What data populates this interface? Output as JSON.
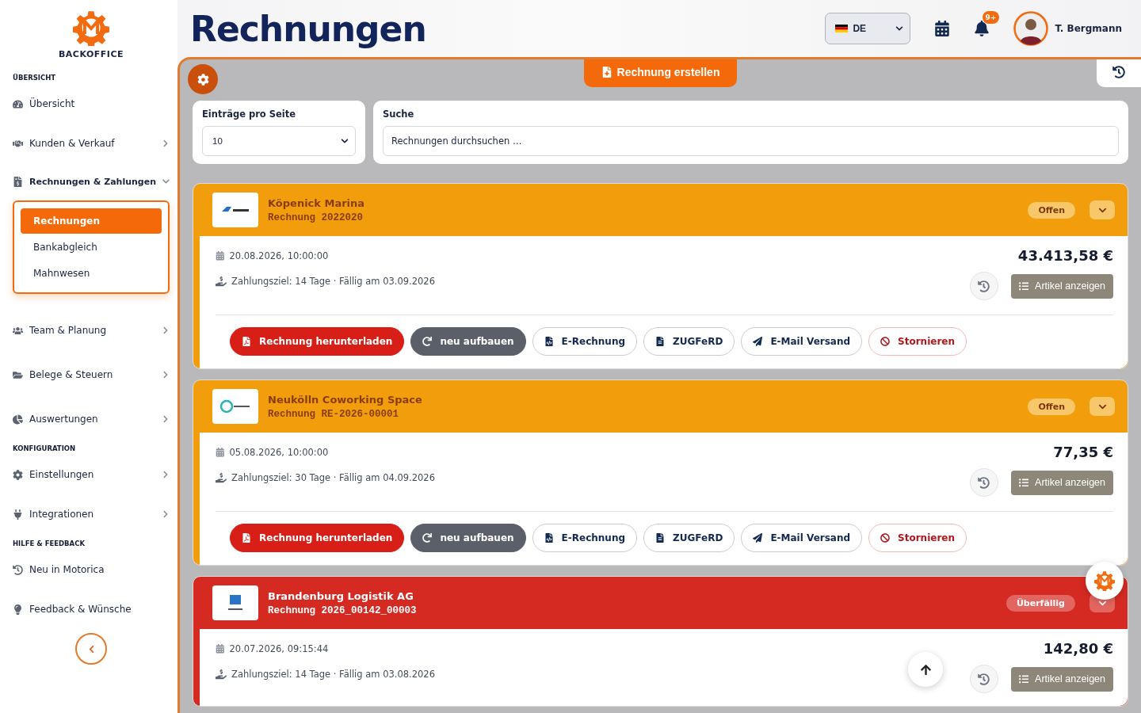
{
  "brand": {
    "name": "BACKOFFICE"
  },
  "sidebar": {
    "sections": [
      {
        "heading": "ÜBERSICHT",
        "items": [
          {
            "label": "Übersicht",
            "expandable": false,
            "expanded": false
          }
        ]
      },
      {
        "items": [
          {
            "label": "Kunden & Verkauf",
            "expandable": true,
            "expanded": false
          },
          {
            "label": "Rechnungen & Zahlungen",
            "expandable": true,
            "expanded": true,
            "children": [
              {
                "label": "Rechnungen",
                "selected": true
              },
              {
                "label": "Bankabgleich",
                "selected": false
              },
              {
                "label": "Mahnwesen",
                "selected": false
              }
            ]
          },
          {
            "label": "Team & Planung",
            "expandable": true,
            "expanded": false
          },
          {
            "label": "Belege & Steuern",
            "expandable": true,
            "expanded": false
          },
          {
            "label": "Auswertungen",
            "expandable": true,
            "expanded": false
          }
        ]
      },
      {
        "heading": "KONFIGURATION",
        "items": [
          {
            "label": "Einstellungen",
            "expandable": true,
            "expanded": false
          },
          {
            "label": "Integrationen",
            "expandable": true,
            "expanded": false
          }
        ]
      },
      {
        "heading": "HILFE & FEEDBACK",
        "items": [
          {
            "label": "Neu in Motorica",
            "expandable": false,
            "expanded": false
          },
          {
            "label": "Feedback & Wünsche",
            "expandable": false,
            "expanded": false
          }
        ]
      }
    ]
  },
  "page_title": "Rechnungen",
  "header": {
    "language": "DE",
    "notifications": "9+",
    "user": "T. Bergmann"
  },
  "create_button": "Rechnung erstellen",
  "filters": {
    "per_page_label": "Einträge pro Seite",
    "per_page": "10",
    "search_label": "Suche",
    "search_placeholder": "Rechnungen durchsuchen …"
  },
  "invoices": [
    {
      "kind": "open",
      "customer": "Köpenick Marina",
      "number": "Rechnung 2022020",
      "status": "Offen",
      "date": "20.08.2026, 10:00:00",
      "terms": "Zahlungsziel: 14 Tage · Fällig am 03.09.2026",
      "amount": "43.413,58 €",
      "items_button": "Artikel anzeigen",
      "actions": [
        {
          "kind": "pdf",
          "label": "Rechnung herunterladen"
        },
        {
          "kind": "rebuild",
          "label": "neu aufbauen"
        },
        {
          "kind": "einvoice",
          "label": "E-Rechnung"
        },
        {
          "kind": "zugferd",
          "label": "ZUGFeRD"
        },
        {
          "kind": "email",
          "label": "E-Mail Versand"
        },
        {
          "kind": "cancel",
          "label": "Stornieren"
        }
      ]
    },
    {
      "kind": "open",
      "customer": "Neukölln Coworking Space",
      "number": "Rechnung RE-2026-00001",
      "status": "Offen",
      "date": "05.08.2026, 10:00:00",
      "terms": "Zahlungsziel: 30 Tage · Fällig am 04.09.2026",
      "amount": "77,35 €",
      "items_button": "Artikel anzeigen",
      "actions": [
        {
          "kind": "pdf",
          "label": "Rechnung herunterladen"
        },
        {
          "kind": "rebuild",
          "label": "neu aufbauen"
        },
        {
          "kind": "einvoice",
          "label": "E-Rechnung"
        },
        {
          "kind": "zugferd",
          "label": "ZUGFeRD"
        },
        {
          "kind": "email",
          "label": "E-Mail Versand"
        },
        {
          "kind": "cancel",
          "label": "Stornieren"
        }
      ]
    },
    {
      "kind": "overdue",
      "customer": "Brandenburg Logistik AG",
      "number": "Rechnung 2026_00142_00003",
      "status": "Überfällig",
      "date": "20.07.2026, 09:15:44",
      "terms": "Zahlungsziel: 14 Tage · Fällig am 03.08.2026",
      "amount": "142,80 €",
      "items_button": "Artikel anzeigen"
    }
  ]
}
